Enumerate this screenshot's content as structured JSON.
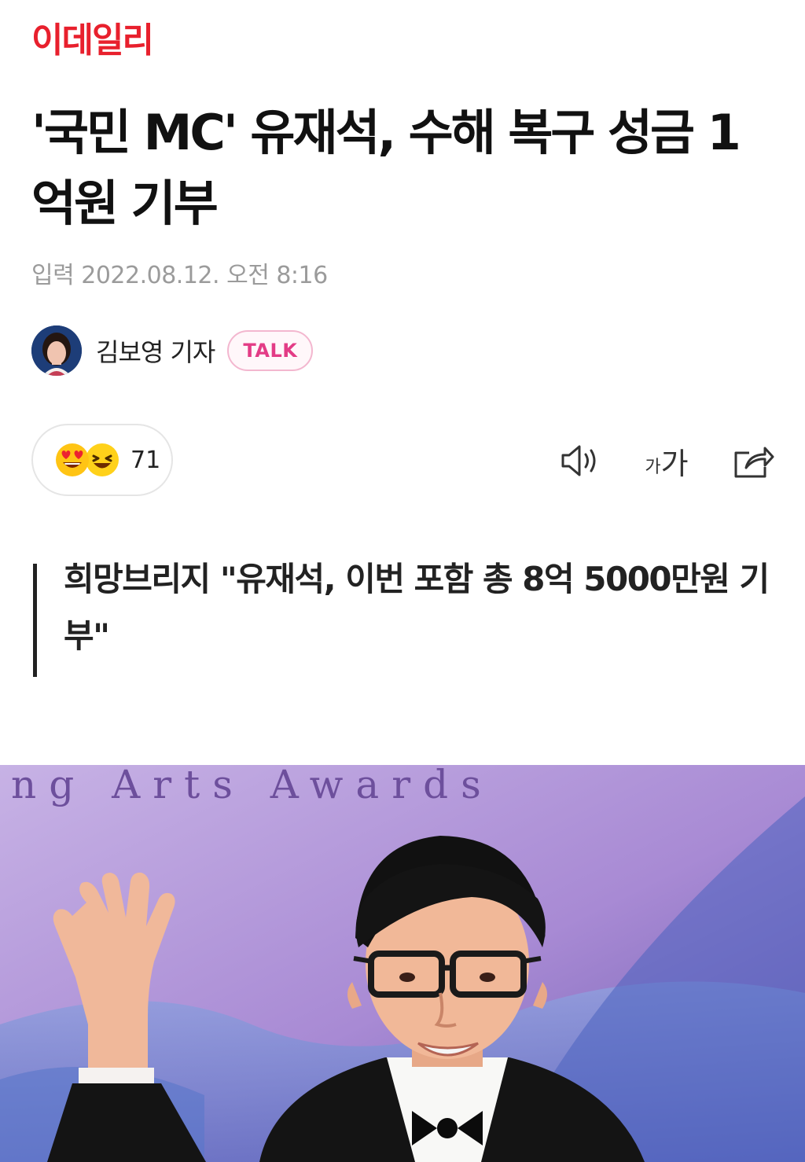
{
  "site": {
    "logo_text": "이데일리",
    "brand_color": "#e8202d"
  },
  "article": {
    "headline": "'국민 MC' 유재석, 수해 복구 성금 1억원 기부",
    "published_label": "입력",
    "published_at": "2022.08.12. 오전 8:16",
    "reporter": {
      "name": "김보영 기자",
      "badge": "TALK"
    },
    "subheadline": "희망브리지 \"유재석, 이번 포함 총 8억 5000만원 기부\""
  },
  "reactions": {
    "emojis": [
      "heart-eyes-emoji-icon",
      "laughing-emoji-icon"
    ],
    "count": "71"
  },
  "toolbar": {
    "audio_icon": "speaker-icon",
    "font_small": "가",
    "font_large": "가",
    "share_icon": "share-icon"
  },
  "photo": {
    "backdrop_text": "ng Arts Awards",
    "colors": {
      "backdrop": "#b79ad9",
      "suit": "#141414"
    }
  }
}
